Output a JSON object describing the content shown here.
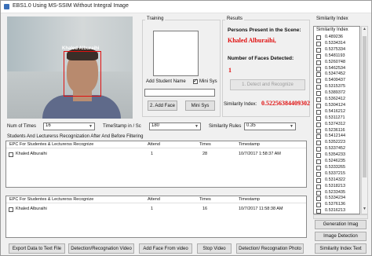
{
  "window": {
    "title": "EBS1.0 Using MS-SSIM Without Integral Image"
  },
  "camera": {
    "face_label": "Khaled Alburaihi"
  },
  "training": {
    "group_label": "Training",
    "student_name_label": "Add Student Name",
    "mini_sys_label": "Mini Sys",
    "mini_sys_checked": true,
    "student_name_value": "",
    "add_face_label": "2. Add Face",
    "mini_sys_button_label": "Mini Sys"
  },
  "results": {
    "group_label": "Results",
    "persons_present_label": "Persons Present in the Scene:",
    "person_name": "Khaled Alburaihi,",
    "faces_detected_label": "Number of Faces Detected:",
    "faces_detected_value": "1",
    "detect_button_label": "1. Detect and Recognize",
    "similarity_index_label": "Similarity Index:",
    "similarity_index_value": "0.52256384409302"
  },
  "controls": {
    "num_times_label": "Num of Times",
    "num_times_value": "16",
    "timestamp_label": "TimeStamp in / Sc",
    "timestamp_value": "180",
    "similarity_rules_label": "Similarity Rules",
    "similarity_rules_value": "0.35"
  },
  "recognition": {
    "title": "Students And Lecturerss Recognization After And Before Filtering",
    "top_table": {
      "columns": [
        "EPC For Studentes & Lecturerss Recognize",
        "Attend",
        "Times",
        "Timestamp"
      ],
      "rows": [
        {
          "name": "Khaled Alburaihi",
          "attend": "1",
          "times": "28",
          "timestamp": "10/7/2017 1:58:37 AM"
        }
      ]
    },
    "bottom_table": {
      "columns": [
        "EPC For Studentes & Lecturerss Recognize",
        "Attend",
        "Times",
        "Timestamp"
      ],
      "rows": [
        {
          "name": "Khaled Alburaihi",
          "attend": "1",
          "times": "16",
          "timestamp": "10/7/2017 11:58:38 AM"
        }
      ]
    }
  },
  "similarity_panel": {
    "group_label": "Similarity Index",
    "list_header": "Similarity Index",
    "items": [
      "0.489236",
      "0.5334314",
      "0.5375334",
      "0.5481193",
      "0.5260748",
      "0.5462534",
      "0.5347452",
      "0.5409437",
      "0.5315375",
      "0.5389372",
      "0.5362412",
      "0.5304124",
      "0.5416212",
      "0.5311271",
      "0.5374312",
      "0.5236116",
      "0.5412144",
      "0.5352223",
      "0.5337452",
      "0.5354233",
      "0.5246235",
      "0.5333265",
      "0.5337215",
      "0.5314322",
      "0.5318213",
      "0.5233435",
      "0.5334234",
      "0.5376136",
      "0.5316213"
    ],
    "generation_button": "Generation Imag",
    "image_detection_button": "Image Detection",
    "similarity_text_button": "Similarity Index Text"
  },
  "bottom_buttons": {
    "export": "Export Data to Text File",
    "detection_video": "Detection/Recognation Video",
    "add_face_video": "Add Face From video",
    "stop_video": "Stop Video",
    "detection_photo": "Detection/ Recognation Photo"
  }
}
